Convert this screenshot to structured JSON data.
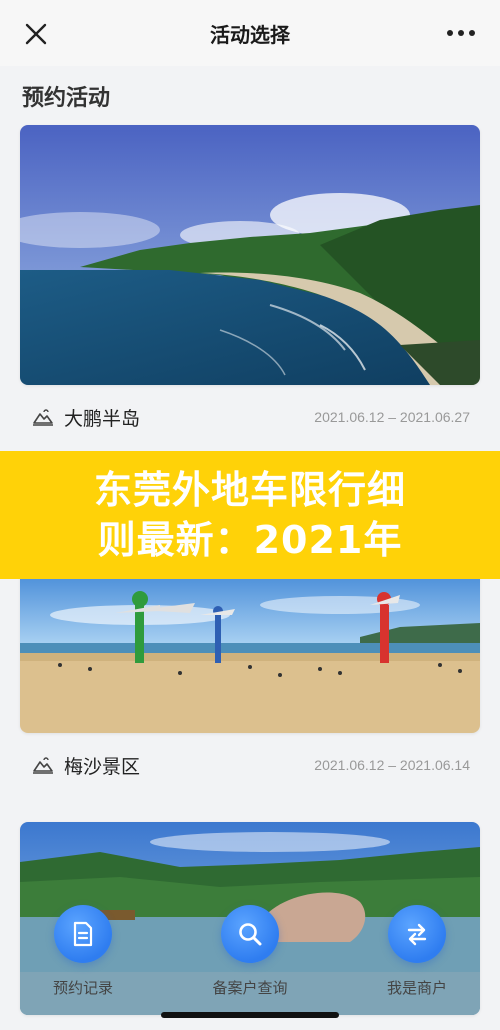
{
  "nav": {
    "title": "活动选择",
    "close_icon": "close-icon",
    "more_icon": "more-icon"
  },
  "section": {
    "title": "预约活动"
  },
  "cards": [
    {
      "name": "大鹏半岛",
      "date": "2021.06.12 – 2021.06.27",
      "icon": "mountain-icon"
    },
    {
      "name": "梅沙景区",
      "date": "2021.06.12 – 2021.06.14",
      "icon": "mountain-icon"
    }
  ],
  "banner": {
    "line1": "东莞外地车限行细",
    "line2": "则最新：2021年",
    "bg_color": "#ffd208"
  },
  "bottom_nav": [
    {
      "label": "预约记录",
      "icon": "document-icon"
    },
    {
      "label": "备案户查询",
      "icon": "search-icon"
    },
    {
      "label": "我是商户",
      "icon": "swap-icon"
    }
  ],
  "colors": {
    "accent": "#2f7df0",
    "background": "#f2f3f5"
  }
}
